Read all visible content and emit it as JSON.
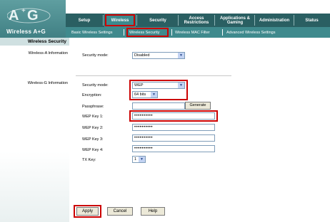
{
  "brand": {
    "logo_text": "Wireless A+G",
    "logo_mark_a": "A",
    "logo_mark_g": "G"
  },
  "nav": {
    "tabs": [
      {
        "label": "Setup"
      },
      {
        "label": "Wireless"
      },
      {
        "label": "Security"
      },
      {
        "label": "Access Restrictions"
      },
      {
        "label": "Applications & Gaming"
      },
      {
        "label": "Administration"
      },
      {
        "label": "Status"
      }
    ],
    "active_tab": "Wireless"
  },
  "subnav": {
    "items": [
      {
        "label": "Basic Wireless Settings"
      },
      {
        "label": "Wireless Security"
      },
      {
        "label": "Wireless MAC Filter"
      },
      {
        "label": "Advanced Wireless Settings"
      }
    ],
    "active_item": "Wireless Security"
  },
  "left": {
    "section_title": "Wireless Security",
    "wireless_a_label": "Wireless-A Information",
    "wireless_g_label": "Wireless-G Information"
  },
  "wireless_a": {
    "security_mode_label": "Security mode:",
    "security_mode_value": "Disabled"
  },
  "wireless_g": {
    "security_mode_label": "Security mode:",
    "security_mode_value": "WEP",
    "encryption_label": "Encryption:",
    "encryption_value": "64 bits",
    "passphrase_label": "Passphrase:",
    "passphrase_value": "",
    "generate_label": "Generate",
    "wep_key_1_label": "WEP Key 1:",
    "wep_key_1_value": "••••••••••",
    "wep_key_2_label": "WEP Key 2:",
    "wep_key_2_value": "••••••••••",
    "wep_key_3_label": "WEP Key 3:",
    "wep_key_3_value": "••••••••••",
    "wep_key_4_label": "WEP Key 4:",
    "wep_key_4_value": "••••••••••",
    "tx_key_label": "TX Key:",
    "tx_key_value": "1"
  },
  "actions": {
    "apply_label": "Apply",
    "cancel_label": "Cancel",
    "help_label": "Help"
  },
  "colors": {
    "header_teal": "#2a5f62",
    "subnav_teal": "#3f8a8d",
    "highlight_red": "#cc0000"
  }
}
